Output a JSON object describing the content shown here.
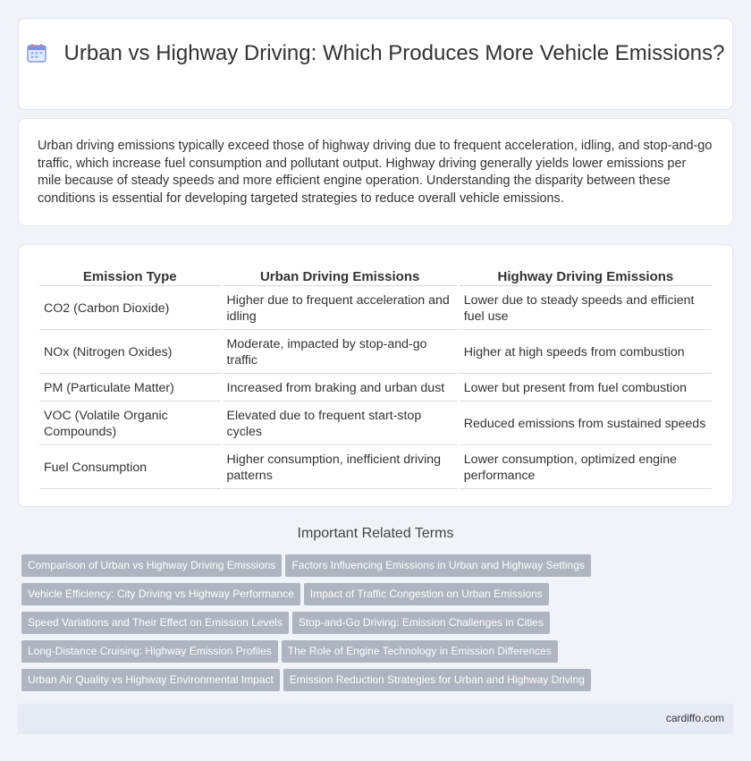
{
  "header": {
    "icon": "calendar-icon",
    "title": "Urban vs Highway Driving: Which Produces More Vehicle Emissions?"
  },
  "intro": {
    "text": "Urban driving emissions typically exceed those of highway driving due to frequent acceleration, idling, and stop-and-go traffic, which increase fuel consumption and pollutant output. Highway driving generally yields lower emissions per mile because of steady speeds and more efficient engine operation. Understanding the disparity between these conditions is essential for developing targeted strategies to reduce overall vehicle emissions."
  },
  "table": {
    "headers": [
      "Emission Type",
      "Urban Driving Emissions",
      "Highway Driving Emissions"
    ],
    "rows": [
      [
        "CO2 (Carbon Dioxide)",
        "Higher due to frequent acceleration and idling",
        "Lower due to steady speeds and efficient fuel use"
      ],
      [
        "NOx (Nitrogen Oxides)",
        "Moderate, impacted by stop-and-go traffic",
        "Higher at high speeds from combustion"
      ],
      [
        "PM (Particulate Matter)",
        "Increased from braking and urban dust",
        "Lower but present from fuel combustion"
      ],
      [
        "VOC (Volatile Organic Compounds)",
        "Elevated due to frequent start-stop cycles",
        "Reduced emissions from sustained speeds"
      ],
      [
        "Fuel Consumption",
        "Higher consumption, inefficient driving patterns",
        "Lower consumption, optimized engine performance"
      ]
    ]
  },
  "related": {
    "title": "Important Related Terms",
    "tags": [
      [
        "Comparison of Urban vs Highway Driving Emissions",
        "Factors Influencing Emissions in Urban and Highway Settings"
      ],
      [
        "Vehicle Efficiency: City Driving vs Highway Performance",
        "Impact of Traffic Congestion on Urban Emissions"
      ],
      [
        "Speed Variations and Their Effect on Emission Levels",
        "Stop-and-Go Driving: Emission Challenges in Cities"
      ],
      [
        "Long-Distance Cruising: Highway Emission Profiles",
        "The Role of Engine Technology in Emission Differences"
      ],
      [
        "Urban Air Quality vs Highway Environmental Impact",
        "Emission Reduction Strategies for Urban and Highway Driving"
      ]
    ]
  },
  "footer": {
    "site": "cardiffo.com"
  }
}
